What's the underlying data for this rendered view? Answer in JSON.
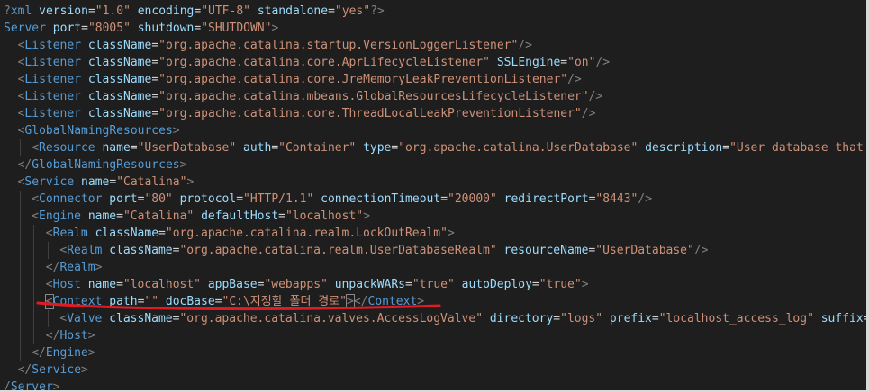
{
  "colors": {
    "background": "#1e1e1e",
    "tag": "#569cd6",
    "attribute": "#9cdcfe",
    "value": "#ce9178",
    "punctuation": "#808080",
    "annotation": "#e01b24"
  },
  "lines": [
    {
      "indent": 0,
      "tokens": [
        [
          "punc",
          "?"
        ],
        [
          "tag",
          "xml"
        ],
        [
          "text",
          " "
        ],
        [
          "attr",
          "version"
        ],
        [
          "text",
          "="
        ],
        [
          "val",
          "\"1.0\""
        ],
        [
          "text",
          " "
        ],
        [
          "attr",
          "encoding"
        ],
        [
          "text",
          "="
        ],
        [
          "val",
          "\"UTF-8\""
        ],
        [
          "text",
          " "
        ],
        [
          "attr",
          "standalone"
        ],
        [
          "text",
          "="
        ],
        [
          "val",
          "\"yes\""
        ],
        [
          "punc",
          "?>"
        ]
      ]
    },
    {
      "indent": 0,
      "tokens": [
        [
          "tag",
          "Server"
        ],
        [
          "text",
          " "
        ],
        [
          "attr",
          "port"
        ],
        [
          "text",
          "="
        ],
        [
          "val",
          "\"8005\""
        ],
        [
          "text",
          " "
        ],
        [
          "attr",
          "shutdown"
        ],
        [
          "text",
          "="
        ],
        [
          "val",
          "\"SHUTDOWN\""
        ],
        [
          "punc",
          ">"
        ]
      ]
    },
    {
      "indent": 1,
      "tokens": [
        [
          "punc",
          "<"
        ],
        [
          "tag",
          "Listener"
        ],
        [
          "text",
          " "
        ],
        [
          "attr",
          "className"
        ],
        [
          "text",
          "="
        ],
        [
          "val",
          "\"org.apache.catalina.startup.VersionLoggerListener\""
        ],
        [
          "punc",
          "/>"
        ]
      ]
    },
    {
      "indent": 1,
      "tokens": [
        [
          "punc",
          "<"
        ],
        [
          "tag",
          "Listener"
        ],
        [
          "text",
          " "
        ],
        [
          "attr",
          "className"
        ],
        [
          "text",
          "="
        ],
        [
          "val",
          "\"org.apache.catalina.core.AprLifecycleListener\""
        ],
        [
          "text",
          " "
        ],
        [
          "attr",
          "SSLEngine"
        ],
        [
          "text",
          "="
        ],
        [
          "val",
          "\"on\""
        ],
        [
          "punc",
          "/>"
        ]
      ]
    },
    {
      "indent": 1,
      "tokens": [
        [
          "punc",
          "<"
        ],
        [
          "tag",
          "Listener"
        ],
        [
          "text",
          " "
        ],
        [
          "attr",
          "className"
        ],
        [
          "text",
          "="
        ],
        [
          "val",
          "\"org.apache.catalina.core.JreMemoryLeakPreventionListener\""
        ],
        [
          "punc",
          "/>"
        ]
      ]
    },
    {
      "indent": 1,
      "tokens": [
        [
          "punc",
          "<"
        ],
        [
          "tag",
          "Listener"
        ],
        [
          "text",
          " "
        ],
        [
          "attr",
          "className"
        ],
        [
          "text",
          "="
        ],
        [
          "val",
          "\"org.apache.catalina.mbeans.GlobalResourcesLifecycleListener\""
        ],
        [
          "punc",
          "/>"
        ]
      ]
    },
    {
      "indent": 1,
      "tokens": [
        [
          "punc",
          "<"
        ],
        [
          "tag",
          "Listener"
        ],
        [
          "text",
          " "
        ],
        [
          "attr",
          "className"
        ],
        [
          "text",
          "="
        ],
        [
          "val",
          "\"org.apache.catalina.core.ThreadLocalLeakPreventionListener\""
        ],
        [
          "punc",
          "/>"
        ]
      ]
    },
    {
      "indent": 1,
      "tokens": [
        [
          "punc",
          "<"
        ],
        [
          "tag",
          "GlobalNamingResources"
        ],
        [
          "punc",
          ">"
        ]
      ]
    },
    {
      "indent": 2,
      "tokens": [
        [
          "punc",
          "<"
        ],
        [
          "tag",
          "Resource"
        ],
        [
          "text",
          " "
        ],
        [
          "attr",
          "name"
        ],
        [
          "text",
          "="
        ],
        [
          "val",
          "\"UserDatabase\""
        ],
        [
          "text",
          " "
        ],
        [
          "attr",
          "auth"
        ],
        [
          "text",
          "="
        ],
        [
          "val",
          "\"Container\""
        ],
        [
          "text",
          " "
        ],
        [
          "attr",
          "type"
        ],
        [
          "text",
          "="
        ],
        [
          "val",
          "\"org.apache.catalina.UserDatabase\""
        ],
        [
          "text",
          " "
        ],
        [
          "attr",
          "description"
        ],
        [
          "text",
          "="
        ],
        [
          "val",
          "\"User database that can"
        ]
      ]
    },
    {
      "indent": 1,
      "tokens": [
        [
          "punc",
          "</"
        ],
        [
          "tag",
          "GlobalNamingResources"
        ],
        [
          "punc",
          ">"
        ]
      ]
    },
    {
      "indent": 1,
      "tokens": [
        [
          "punc",
          "<"
        ],
        [
          "tag",
          "Service"
        ],
        [
          "text",
          " "
        ],
        [
          "attr",
          "name"
        ],
        [
          "text",
          "="
        ],
        [
          "val",
          "\"Catalina\""
        ],
        [
          "punc",
          ">"
        ]
      ]
    },
    {
      "indent": 2,
      "tokens": [
        [
          "punc",
          "<"
        ],
        [
          "tag",
          "Connector"
        ],
        [
          "text",
          " "
        ],
        [
          "attr",
          "port"
        ],
        [
          "text",
          "="
        ],
        [
          "val",
          "\"80\""
        ],
        [
          "text",
          " "
        ],
        [
          "attr",
          "protocol"
        ],
        [
          "text",
          "="
        ],
        [
          "val",
          "\"HTTP/1.1\""
        ],
        [
          "text",
          " "
        ],
        [
          "attr",
          "connectionTimeout"
        ],
        [
          "text",
          "="
        ],
        [
          "val",
          "\"20000\""
        ],
        [
          "text",
          " "
        ],
        [
          "attr",
          "redirectPort"
        ],
        [
          "text",
          "="
        ],
        [
          "val",
          "\"8443\""
        ],
        [
          "punc",
          "/>"
        ]
      ]
    },
    {
      "indent": 2,
      "tokens": [
        [
          "punc",
          "<"
        ],
        [
          "tag",
          "Engine"
        ],
        [
          "text",
          " "
        ],
        [
          "attr",
          "name"
        ],
        [
          "text",
          "="
        ],
        [
          "val",
          "\"Catalina\""
        ],
        [
          "text",
          " "
        ],
        [
          "attr",
          "defaultHost"
        ],
        [
          "text",
          "="
        ],
        [
          "val",
          "\"localhost\""
        ],
        [
          "punc",
          ">"
        ]
      ]
    },
    {
      "indent": 3,
      "tokens": [
        [
          "punc",
          "<"
        ],
        [
          "tag",
          "Realm"
        ],
        [
          "text",
          " "
        ],
        [
          "attr",
          "className"
        ],
        [
          "text",
          "="
        ],
        [
          "val",
          "\"org.apache.catalina.realm.LockOutRealm\""
        ],
        [
          "punc",
          ">"
        ]
      ]
    },
    {
      "indent": 4,
      "tokens": [
        [
          "punc",
          "<"
        ],
        [
          "tag",
          "Realm"
        ],
        [
          "text",
          " "
        ],
        [
          "attr",
          "className"
        ],
        [
          "text",
          "="
        ],
        [
          "val",
          "\"org.apache.catalina.realm.UserDatabaseRealm\""
        ],
        [
          "text",
          " "
        ],
        [
          "attr",
          "resourceName"
        ],
        [
          "text",
          "="
        ],
        [
          "val",
          "\"UserDatabase\""
        ],
        [
          "punc",
          "/>"
        ]
      ]
    },
    {
      "indent": 3,
      "tokens": [
        [
          "punc",
          "</"
        ],
        [
          "tag",
          "Realm"
        ],
        [
          "punc",
          ">"
        ]
      ]
    },
    {
      "indent": 3,
      "tokens": [
        [
          "punc",
          "<"
        ],
        [
          "tag",
          "Host"
        ],
        [
          "text",
          " "
        ],
        [
          "attr",
          "name"
        ],
        [
          "text",
          "="
        ],
        [
          "val",
          "\"localhost\""
        ],
        [
          "text",
          " "
        ],
        [
          "attr",
          "appBase"
        ],
        [
          "text",
          "="
        ],
        [
          "val",
          "\"webapps\""
        ],
        [
          "text",
          " "
        ],
        [
          "attr",
          "unpackWARs"
        ],
        [
          "text",
          "="
        ],
        [
          "val",
          "\"true\""
        ],
        [
          "text",
          " "
        ],
        [
          "attr",
          "autoDeploy"
        ],
        [
          "text",
          "="
        ],
        [
          "val",
          "\"true\""
        ],
        [
          "punc",
          ">"
        ]
      ]
    },
    {
      "indent": 3,
      "tokens": [
        [
          "box",
          "<"
        ],
        [
          "tag",
          "Context"
        ],
        [
          "text",
          " "
        ],
        [
          "attr",
          "path"
        ],
        [
          "text",
          "="
        ],
        [
          "val",
          "\"\""
        ],
        [
          "text",
          " "
        ],
        [
          "attr",
          "docBase"
        ],
        [
          "text",
          "="
        ],
        [
          "val",
          "\"C:\\지정할 폴더 경로\""
        ],
        [
          "box",
          ">"
        ],
        [
          "punc",
          "</"
        ],
        [
          "tag",
          "Context"
        ],
        [
          "punc",
          ">"
        ]
      ]
    },
    {
      "indent": 4,
      "tokens": [
        [
          "punc",
          "<"
        ],
        [
          "tag",
          "Valve"
        ],
        [
          "text",
          " "
        ],
        [
          "attr",
          "className"
        ],
        [
          "text",
          "="
        ],
        [
          "val",
          "\"org.apache.catalina.valves.AccessLogValve\""
        ],
        [
          "text",
          " "
        ],
        [
          "attr",
          "directory"
        ],
        [
          "text",
          "="
        ],
        [
          "val",
          "\"logs\""
        ],
        [
          "text",
          " "
        ],
        [
          "attr",
          "prefix"
        ],
        [
          "text",
          "="
        ],
        [
          "val",
          "\"localhost_access_log\""
        ],
        [
          "text",
          " "
        ],
        [
          "attr",
          "suffix"
        ],
        [
          "text",
          "="
        ],
        [
          "val",
          "\".tx"
        ]
      ]
    },
    {
      "indent": 3,
      "tokens": [
        [
          "punc",
          "</"
        ],
        [
          "tag",
          "Host"
        ],
        [
          "punc",
          ">"
        ]
      ]
    },
    {
      "indent": 2,
      "tokens": [
        [
          "punc",
          "</"
        ],
        [
          "tag",
          "Engine"
        ],
        [
          "punc",
          ">"
        ]
      ]
    },
    {
      "indent": 1,
      "tokens": [
        [
          "punc",
          "</"
        ],
        [
          "tag",
          "Service"
        ],
        [
          "punc",
          ">"
        ]
      ]
    },
    {
      "indent": 0,
      "tokens": [
        [
          "punc",
          "/"
        ],
        [
          "tag",
          "Server"
        ],
        [
          "punc",
          ">"
        ]
      ]
    }
  ]
}
